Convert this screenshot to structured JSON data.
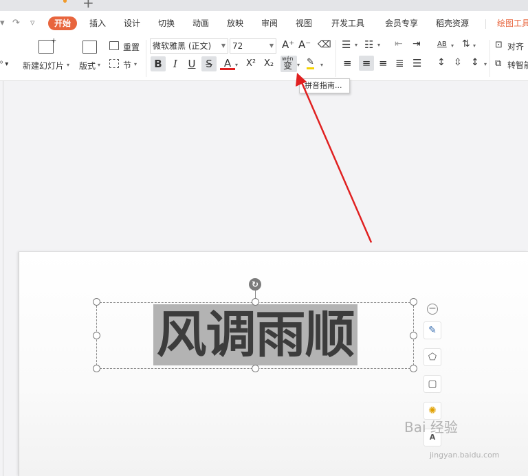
{
  "quick_access": {
    "redo": "↷",
    "more": "▿"
  },
  "menu": {
    "new_tab": "+",
    "tabs": [
      {
        "label": "开始",
        "active": true
      },
      {
        "label": "插入"
      },
      {
        "label": "设计"
      },
      {
        "label": "切换"
      },
      {
        "label": "动画"
      },
      {
        "label": "放映"
      },
      {
        "label": "审阅"
      },
      {
        "label": "视图"
      },
      {
        "label": "开发工具"
      },
      {
        "label": "会员专享"
      },
      {
        "label": "稻壳资源"
      },
      {
        "label": "绘图工具"
      }
    ]
  },
  "ribbon": {
    "new_slide": "新建幻灯片",
    "layout": "版式",
    "reset": "重置",
    "section": "节",
    "font_name": "微软雅黑 (正文)",
    "font_size": "72",
    "bold": "B",
    "italic": "I",
    "underline": "U",
    "strike": "S",
    "font_color": "A",
    "superscript": "X²",
    "subscript": "X₂",
    "pinyin_top": "wén",
    "pinyin_char": "变",
    "grow": "A⁺",
    "shrink": "A⁻",
    "align_label": "对齐",
    "smart_label": "转智能",
    "left_partial": "⁰ ▾",
    "text_dir": "AB"
  },
  "tooltip": {
    "text": "拼音指南..."
  },
  "slide": {
    "title_text": "风调雨顺"
  },
  "side_tools": {
    "text_fill_label": "A"
  },
  "watermark": {
    "brand": "Bai 经验",
    "url": "jingyan.baidu.com"
  },
  "colors": {
    "accent": "#e8653d",
    "arrow": "#e02020",
    "font_color_bar": "#e02020",
    "highlight_bar": "#f5d300"
  }
}
